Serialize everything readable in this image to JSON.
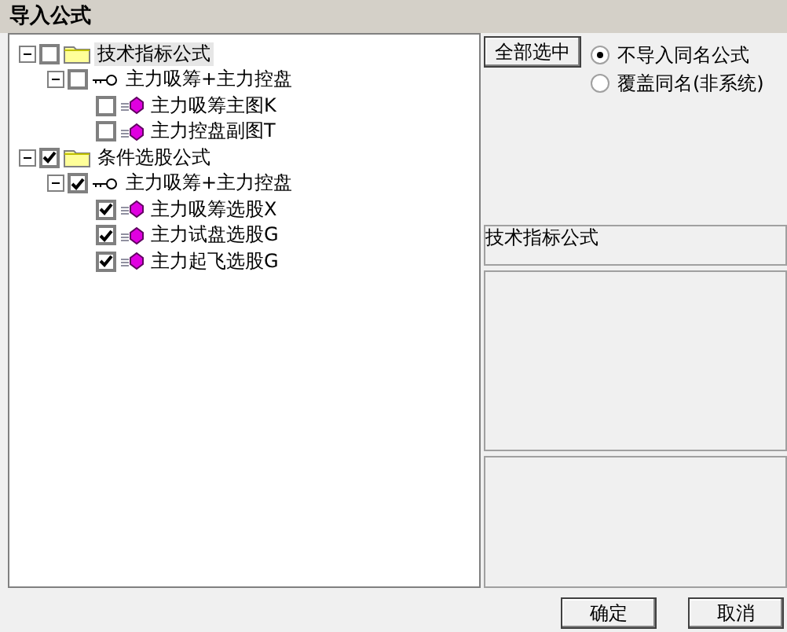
{
  "window": {
    "title": "导入公式"
  },
  "tree": [
    {
      "label": "技术指标公式",
      "kind": "folder",
      "checked": false,
      "expanded": true,
      "selected": true,
      "children": [
        {
          "label": "主力吸筹+主力控盘",
          "kind": "group",
          "checked": false,
          "expanded": true,
          "selected": false,
          "children": [
            {
              "label": "主力吸筹主图K",
              "kind": "formula",
              "checked": false,
              "selected": false
            },
            {
              "label": "主力控盘副图T",
              "kind": "formula",
              "checked": false,
              "selected": false
            }
          ]
        }
      ]
    },
    {
      "label": "条件选股公式",
      "kind": "folder",
      "checked": true,
      "expanded": true,
      "selected": false,
      "children": [
        {
          "label": "主力吸筹+主力控盘",
          "kind": "group",
          "checked": true,
          "expanded": true,
          "selected": false,
          "children": [
            {
              "label": "主力吸筹选股X",
              "kind": "formula",
              "checked": true,
              "selected": false
            },
            {
              "label": "主力试盘选股G",
              "kind": "formula",
              "checked": true,
              "selected": false
            },
            {
              "label": "主力起飞选股G",
              "kind": "formula",
              "checked": true,
              "selected": false
            }
          ]
        }
      ]
    }
  ],
  "select_all_button": "全部选中",
  "options": [
    {
      "label": "不导入同名公式",
      "selected": true
    },
    {
      "label": "覆盖同名(非系统)",
      "selected": false
    }
  ],
  "description": {
    "title": "技术指标公式"
  },
  "buttons": [
    "确定",
    "取消"
  ]
}
